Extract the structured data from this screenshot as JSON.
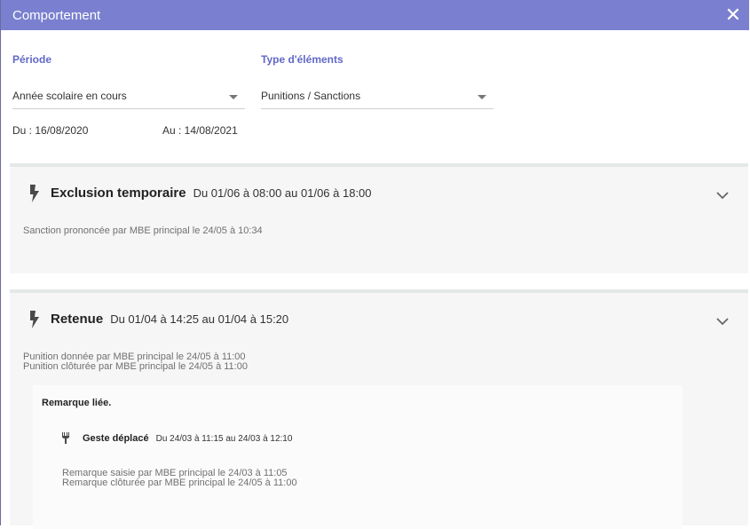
{
  "window": {
    "title": "Comportement"
  },
  "filters": {
    "periode_label": "Période",
    "type_label": "Type d'éléments",
    "periode_value": "Année scolaire en cours",
    "type_value": "Punitions / Sanctions",
    "du": "Du : 16/08/2020",
    "au": "Au : 14/08/2021"
  },
  "items": [
    {
      "title": "Exclusion temporaire",
      "dates": "Du 01/06 à 08:00 au 01/06 à 18:00",
      "lines": [
        "Sanction prononcée par MBE principal le 24/05 à 10:34"
      ]
    },
    {
      "title": "Retenue",
      "dates": "Du 01/04 à 14:25 au 01/04 à 15:20",
      "lines": [
        "Punition donnée par MBE principal le 24/05 à 11:00",
        "Punition clôturée par MBE principal le 24/05 à 11:00"
      ],
      "remark": {
        "label": "Remarque liée.",
        "title": "Geste déplacé",
        "dates": "Du 24/03 à 11:15 au 24/03 à 12:10",
        "lines": [
          "Remarque saisie par MBE principal le 24/03 à 11:05",
          "Remarque clôturée par MBE principal le 24/05 à 11:00"
        ]
      }
    }
  ],
  "colors": {
    "header": "#7a80cf",
    "accent": "#6168c7",
    "icon": "#4a4a4a"
  }
}
